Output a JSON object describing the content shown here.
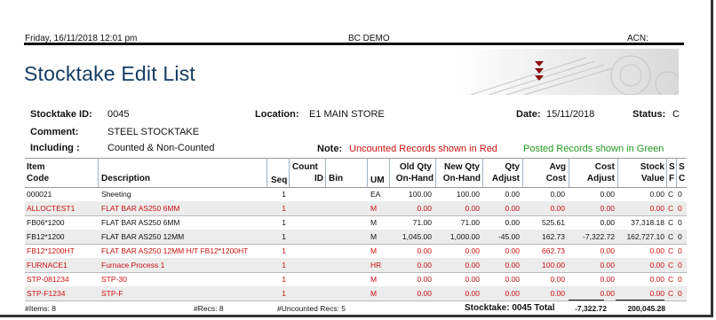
{
  "header": {
    "datetime": "Friday, 16/11/2018 12:01 pm",
    "company": "BC DEMO",
    "acn_label": "ACN:",
    "title": "Stocktake Edit List"
  },
  "info": {
    "id_label": "Stocktake ID:",
    "id_value": "0045",
    "location_label": "Location:",
    "location_value": "E1  MAIN STORE",
    "date_label": "Date:",
    "date_value": "15/11/2018",
    "status_label": "Status:",
    "status_value": "C",
    "comment_label": "Comment:",
    "comment_value": "STEEL STOCKTAKE",
    "including_label": "Including :",
    "including_value": "Counted & Non-Counted",
    "note_label": "Note:",
    "note_red": "Uncounted Records shown in Red",
    "note_green": "Posted Records shown in Green"
  },
  "columns": {
    "item_code_1": "Item",
    "item_code_2": "Code",
    "description": "Description",
    "seq": "Seq",
    "count_id_1": "Count",
    "count_id_2": "ID",
    "bin": "Bin",
    "um": "UM",
    "old_qty_1": "Old Qty",
    "old_qty_2": "On-Hand",
    "new_qty_1": "New Qty",
    "new_qty_2": "On-Hand",
    "qty_adj_1": "Qty",
    "qty_adj_2": "Adjust",
    "avg_cost_1": "Avg",
    "avg_cost_2": "Cost",
    "cost_adj_1": "Cost",
    "cost_adj_2": "Adjust",
    "stock_val_1": "Stock",
    "stock_val_2": "Value",
    "s": "S",
    "f": "F",
    "c1": "S",
    "c2": "C"
  },
  "rows": [
    {
      "code": "000021",
      "desc": "Sheeting",
      "seq": "1",
      "um": "EA",
      "old": "100.00",
      "new": "100.00",
      "qty_adj": "0.00",
      "avg": "0.00",
      "cost_adj": "0.00",
      "value": "0.00",
      "s": "C",
      "f": "0",
      "uncounted": false
    },
    {
      "code": "ALLOCTEST1",
      "desc": "FLAT BAR AS250 6MM",
      "seq": "1",
      "um": "M",
      "old": "0.00",
      "new": "0.00",
      "qty_adj": "0.00",
      "avg": "0.00",
      "cost_adj": "0.00",
      "value": "0.00",
      "s": "C",
      "f": "0",
      "uncounted": true
    },
    {
      "code": "FB06*1200",
      "desc": "FLAT BAR AS250 6MM",
      "seq": "1",
      "um": "M",
      "old": "71.00",
      "new": "71.00",
      "qty_adj": "0.00",
      "avg": "525.61",
      "cost_adj": "0.00",
      "value": "37,318.18",
      "s": "C",
      "f": "0",
      "uncounted": false
    },
    {
      "code": "FB12*1200",
      "desc": "FLAT BAR AS250 12MM",
      "seq": "1",
      "um": "M",
      "old": "1,045.00",
      "new": "1,000.00",
      "qty_adj": "-45.00",
      "avg": "162.73",
      "cost_adj": "-7,322.72",
      "value": "162,727.10",
      "s": "C",
      "f": "0",
      "uncounted": false
    },
    {
      "code": "FB12*1200HT",
      "desc": "FLAT BAR AS250 12MM H/T FB12*1200HT",
      "seq": "1",
      "um": "M",
      "old": "0.00",
      "new": "0.00",
      "qty_adj": "0.00",
      "avg": "662.73",
      "cost_adj": "0.00",
      "value": "0.00",
      "s": "C",
      "f": "0",
      "uncounted": true
    },
    {
      "code": "FURNACE1",
      "desc": "Furnace Process 1",
      "seq": "1",
      "um": "HR",
      "old": "0.00",
      "new": "0.00",
      "qty_adj": "0.00",
      "avg": "100.00",
      "cost_adj": "0.00",
      "value": "0.00",
      "s": "C",
      "f": "0",
      "uncounted": true
    },
    {
      "code": "STP-081234",
      "desc": "STP-30",
      "seq": "1",
      "um": "M",
      "old": "0.00",
      "new": "0.00",
      "qty_adj": "0.00",
      "avg": "0.00",
      "cost_adj": "0.00",
      "value": "0.00",
      "s": "C",
      "f": "0",
      "uncounted": true
    },
    {
      "code": "STP-F1234",
      "desc": "STP-F",
      "seq": "1",
      "um": "M",
      "old": "0.00",
      "new": "0.00",
      "qty_adj": "0.00",
      "avg": "0.00",
      "cost_adj": "0.00",
      "value": "0.00",
      "s": "C",
      "f": "0",
      "uncounted": true
    }
  ],
  "footer": {
    "items": "#Items: 8",
    "recs": "#Recs: 8",
    "uncounted": "#Uncounted Recs: 5",
    "total_label": "Stocktake: 0045 Total",
    "total_cost_adj": "-7,322.72",
    "total_value": "200,045.28"
  },
  "colors": {
    "title": "#143c64",
    "uncounted": "#cc1111",
    "posted": "#1f9a1f",
    "logo_arrow": "#8a1010"
  },
  "icons": {
    "logo": "gear-watermark-logo",
    "arrows": "triple-down-arrow-icon"
  }
}
